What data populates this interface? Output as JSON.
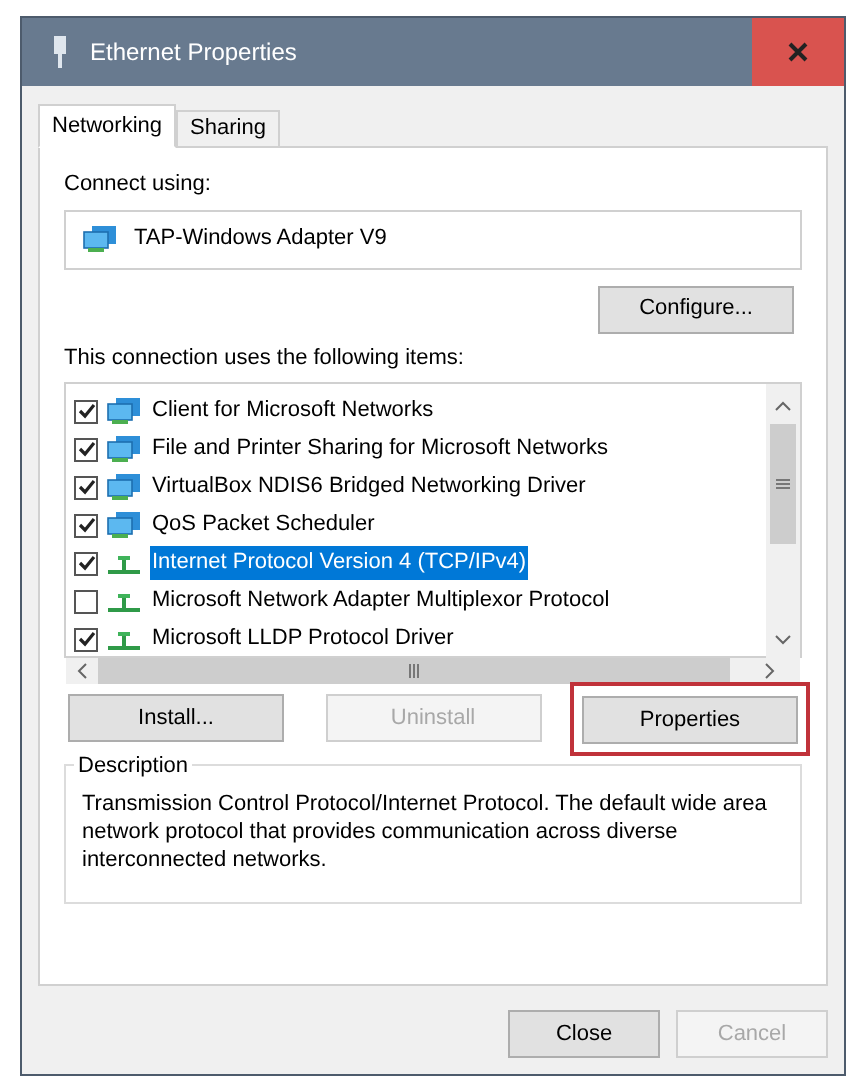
{
  "window": {
    "title": "Ethernet Properties"
  },
  "tabs": [
    {
      "label": "Networking",
      "selected": true
    },
    {
      "label": "Sharing",
      "selected": false
    }
  ],
  "connect_using": {
    "label": "Connect using:",
    "adapter": "TAP-Windows Adapter V9"
  },
  "configure_button": {
    "label": "Configure...",
    "disabled": false
  },
  "items_label": "This connection uses the following items:",
  "items": [
    {
      "label": "Client for Microsoft Networks",
      "kind": "service",
      "checked": true,
      "selected": false
    },
    {
      "label": "File and Printer Sharing for Microsoft Networks",
      "kind": "service",
      "checked": true,
      "selected": false
    },
    {
      "label": "VirtualBox NDIS6 Bridged Networking Driver",
      "kind": "service",
      "checked": true,
      "selected": false
    },
    {
      "label": "QoS Packet Scheduler",
      "kind": "service",
      "checked": true,
      "selected": false
    },
    {
      "label": "Internet Protocol Version 4 (TCP/IPv4)",
      "kind": "protocol",
      "checked": true,
      "selected": true
    },
    {
      "label": "Microsoft Network Adapter Multiplexor Protocol",
      "kind": "protocol",
      "checked": false,
      "selected": false
    },
    {
      "label": "Microsoft LLDP Protocol Driver",
      "kind": "protocol",
      "checked": true,
      "selected": false
    }
  ],
  "item_buttons": [
    {
      "label": "Install...",
      "disabled": false,
      "highlighted": false
    },
    {
      "label": "Uninstall",
      "disabled": true,
      "highlighted": false
    },
    {
      "label": "Properties",
      "disabled": false,
      "highlighted": true
    }
  ],
  "description": {
    "title": "Description",
    "text": "Transmission Control Protocol/Internet Protocol. The default wide area network protocol that provides communication across diverse interconnected networks."
  },
  "dialog_buttons": [
    {
      "label": "Close",
      "disabled": false
    },
    {
      "label": "Cancel",
      "disabled": true
    }
  ]
}
